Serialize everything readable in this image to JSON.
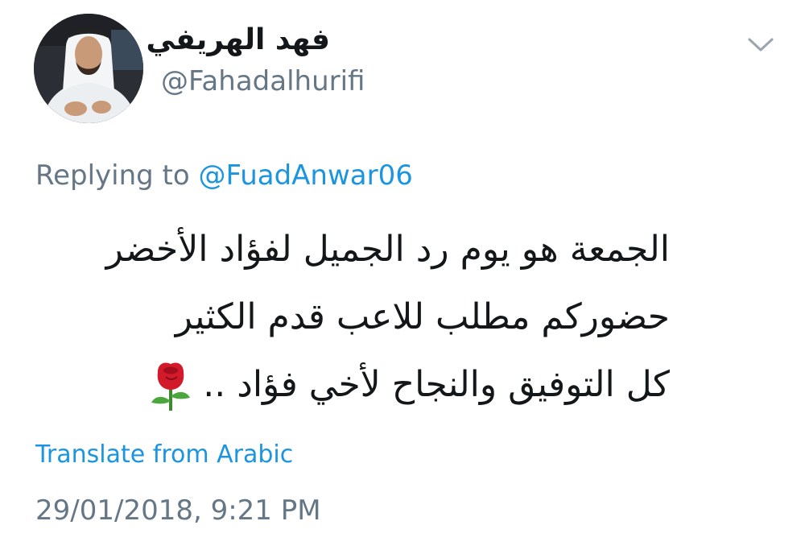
{
  "tweet": {
    "author": {
      "display_name": "فهد الهريفي",
      "handle": "@Fahadalhurifi"
    },
    "menu_icon": "chevron-down-icon",
    "replying_prefix": "Replying to ",
    "replying_to": "@FuadAnwar06",
    "text_lines": [
      "الجمعة هو يوم رد الجميل لفؤاد الأخضر",
      "حضوركم مطلب للاعب قدم الكثير",
      "كل التوفيق والنجاح لأخي فؤاد .."
    ],
    "emoji_icon": "rose-emoji",
    "translate_label": "Translate from Arabic",
    "timestamp": "29/01/2018, 9:21 PM"
  },
  "colors": {
    "text": "#14171a",
    "secondary": "#657786",
    "link": "#1b95e0",
    "background": "#ffffff"
  }
}
